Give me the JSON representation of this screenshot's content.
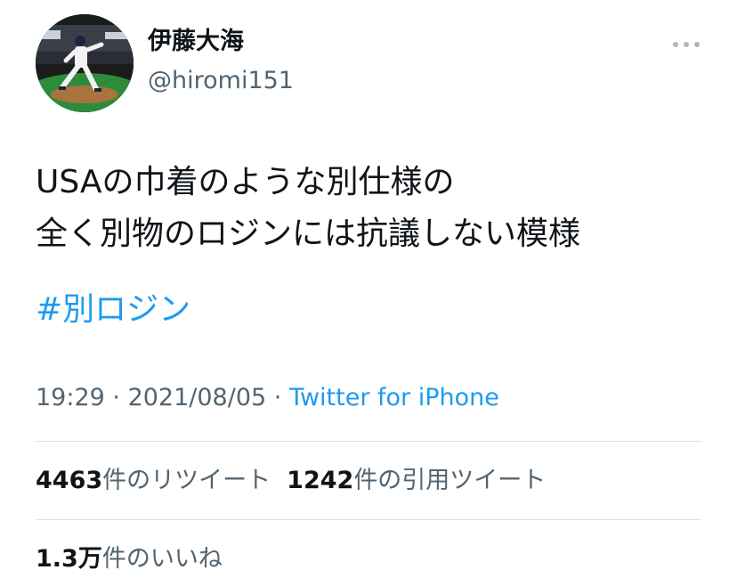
{
  "user": {
    "display_name": "伊藤大海",
    "handle": "@hiromi151",
    "avatar_icon": "baseball-pitcher-photo"
  },
  "tweet": {
    "text_lines": [
      "USAの巾着のような別仕様の",
      "全く別物のロジンには抗議しない模様"
    ],
    "hashtag": "#別ロジン",
    "time": "19:29",
    "separator": " · ",
    "date": "2021/08/05",
    "source": "Twitter for iPhone"
  },
  "stats": {
    "retweets": {
      "count": "4463",
      "label": "件のリツイート"
    },
    "quotes": {
      "count": "1242",
      "label": "件の引用ツイート"
    },
    "likes": {
      "count": "1.3万",
      "label": "件のいいね"
    }
  },
  "colors": {
    "text": "#0f1419",
    "secondary": "#536471",
    "link": "#1d9bf0",
    "divider": "#dde3e8"
  }
}
